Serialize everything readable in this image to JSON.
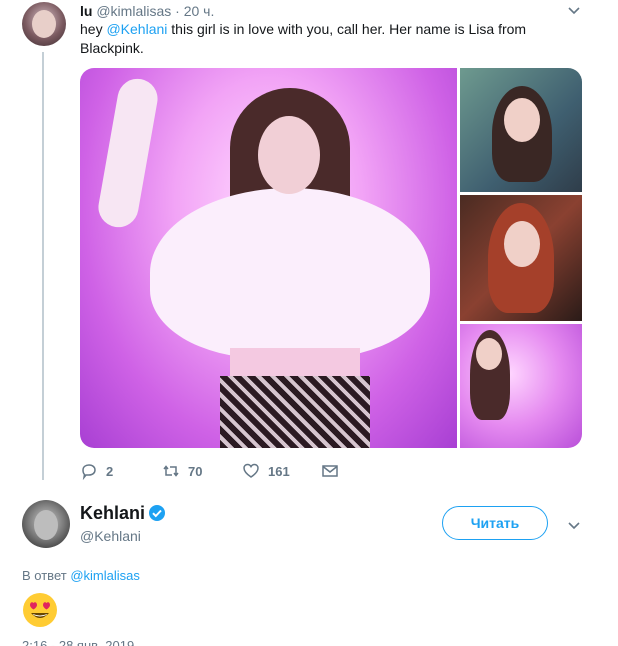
{
  "tweet1": {
    "name": "lu",
    "handle": "@kimlalisas",
    "dot": "·",
    "time": "20 ч.",
    "text_prefix": "hey ",
    "mention": "@Kehlani",
    "text_suffix": " this girl is in love with you, call her. Her name is Lisa from Blackpink.",
    "actions": {
      "reply_count": "2",
      "retweet_count": "70",
      "like_count": "161"
    }
  },
  "tweet2": {
    "name": "Kehlani",
    "handle": "@Kehlani",
    "follow_label": "Читать",
    "reply_to_label": "В ответ",
    "reply_to_handle": "@kimlalisas",
    "emoji": "heart-eyes-emoji",
    "footer_time": "2:16 - 28 янв. 2019"
  },
  "colors": {
    "accent": "#1da1f2",
    "muted": "#657786",
    "text": "#14171a"
  }
}
